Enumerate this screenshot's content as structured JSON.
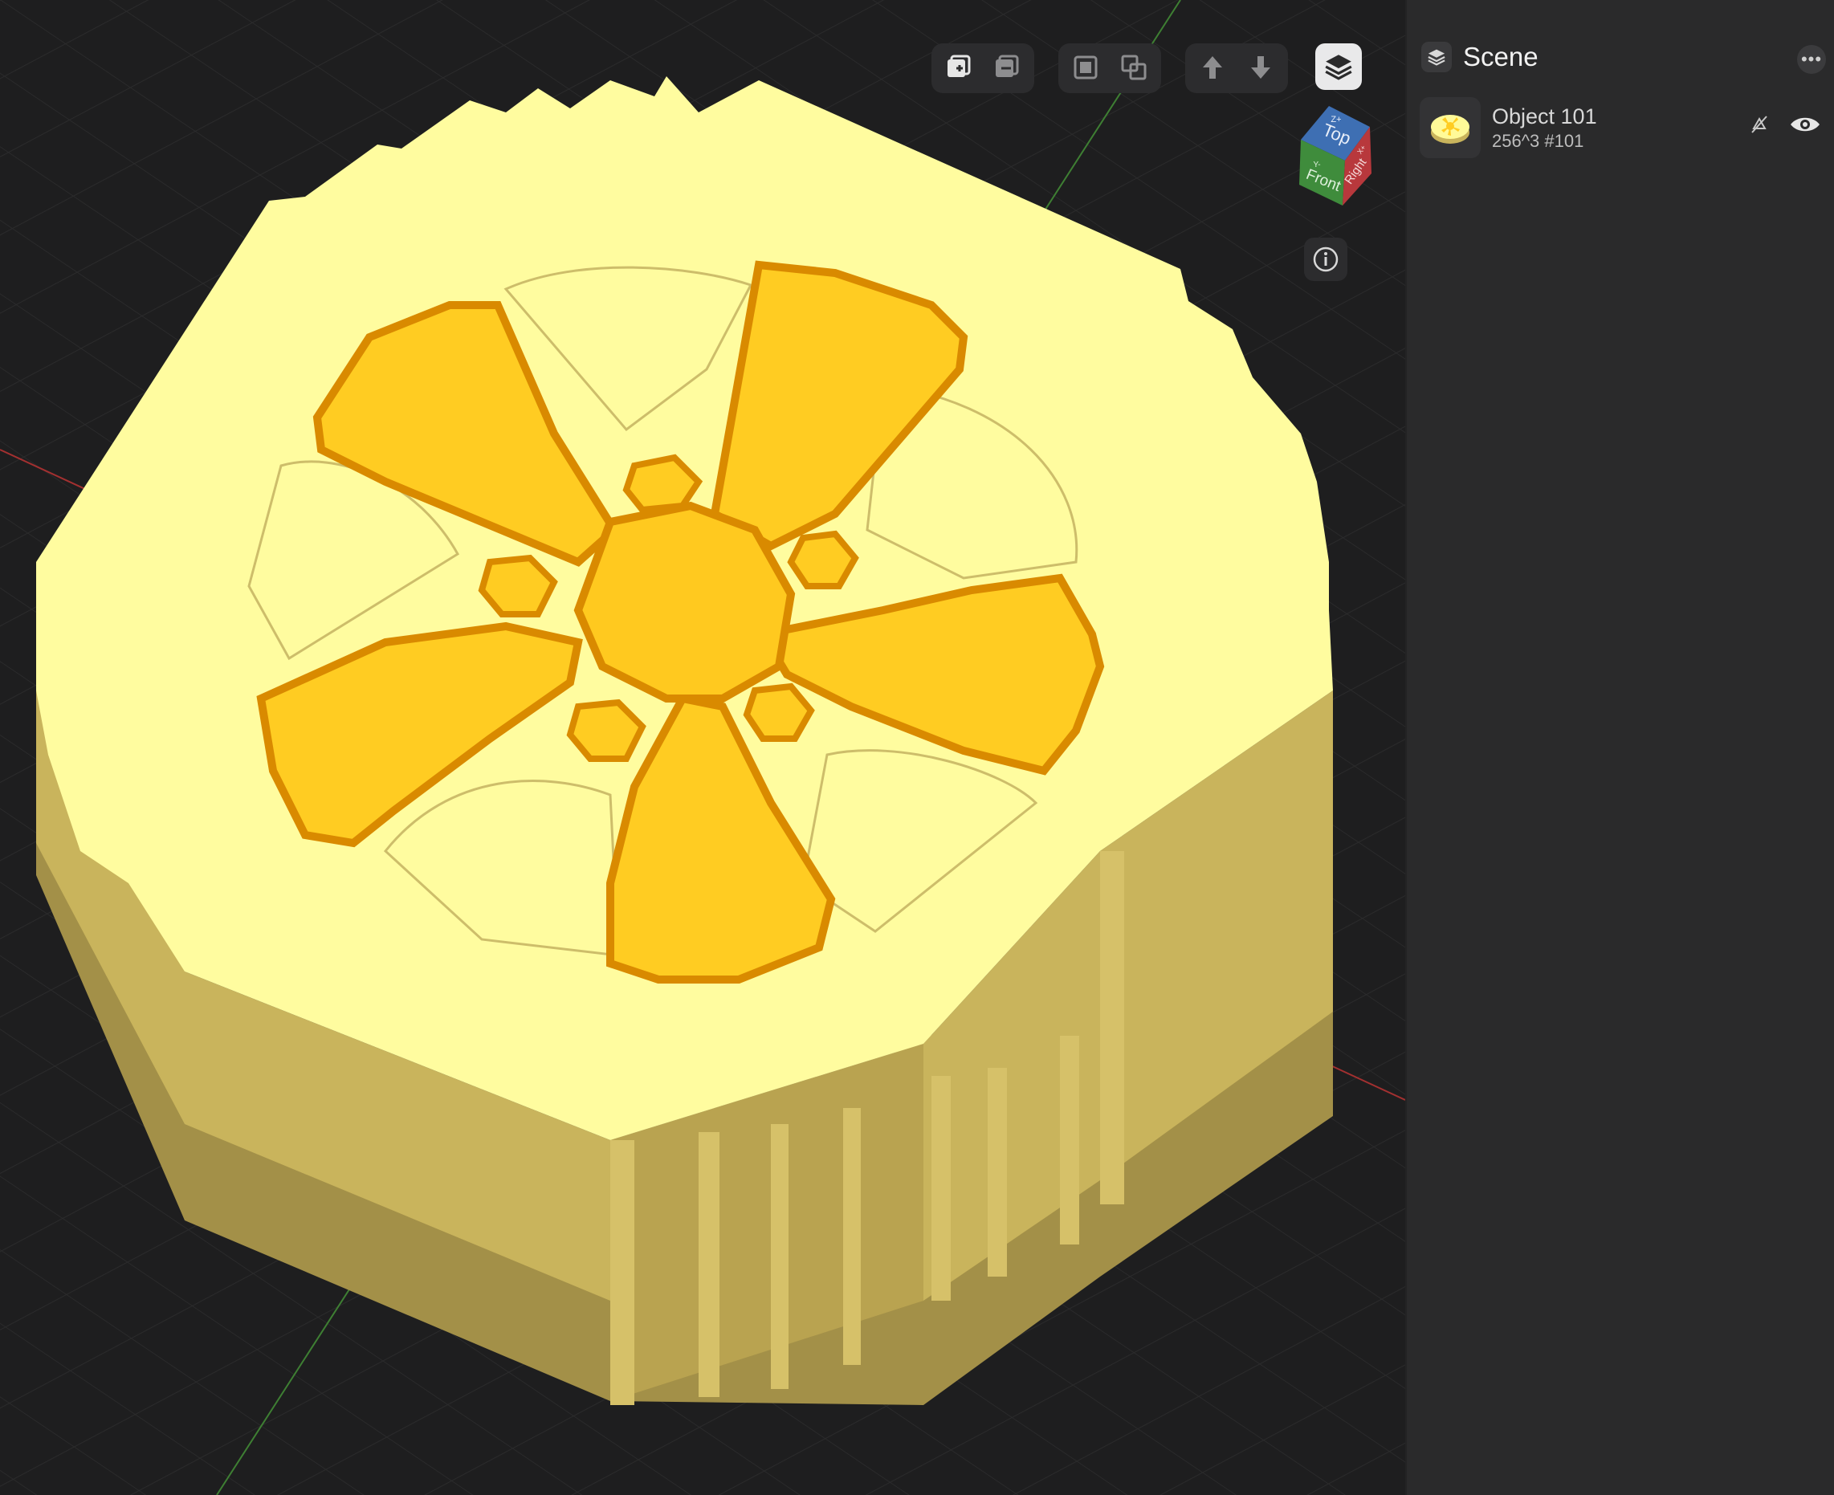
{
  "toolbar": {
    "groups": [
      {
        "buttons": [
          {
            "icon": "add-layer-icon"
          },
          {
            "icon": "remove-layer-icon"
          }
        ]
      },
      {
        "buttons": [
          {
            "icon": "merge-icon"
          },
          {
            "icon": "split-icon"
          }
        ]
      },
      {
        "buttons": [
          {
            "icon": "move-up-icon"
          },
          {
            "icon": "move-down-icon"
          }
        ]
      }
    ],
    "layers_icon": "layers-icon"
  },
  "viewcube": {
    "top": "Top",
    "front": "Front",
    "right": "Right",
    "z_axis": "Z+",
    "y_axis": "Y-",
    "x_axis": "X+",
    "colors": {
      "top": "#3e6fb3",
      "front": "#3f8c3c",
      "right": "#b8383c"
    }
  },
  "info_icon": "info-icon",
  "scene_panel": {
    "title": "Scene",
    "more_icon": "ellipsis-icon",
    "objects": [
      {
        "name": "Object 101",
        "subtitle": "256^3 #101",
        "hide_icon": "eye-slash-icon",
        "visibility_icon": "eye-icon"
      }
    ]
  },
  "colors": {
    "background": "#1e1e1f",
    "panel": "#2a2a2b",
    "model_top": "#fffb9e",
    "model_side": "#c8b15a",
    "flower": "#ffcc22",
    "flower_edge": "#d98a00",
    "grid_x_axis": "#c23434",
    "grid_y_axis": "#4a9a3a"
  }
}
